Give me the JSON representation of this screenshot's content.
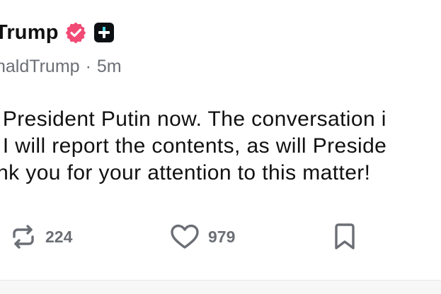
{
  "post": {
    "author_name": "Trump",
    "handle": "naldTrump",
    "separator": "·",
    "time_ago": "5m",
    "body_lines": [
      "o President Putin now. The conversation i",
      "d I will report the contents, as will Preside",
      "ank you for your attention to this matter!"
    ]
  },
  "actions": {
    "repost_count": "224",
    "like_count": "979"
  },
  "icons": {
    "verified": "verified-badge-icon",
    "plus": "plus-badge-icon",
    "repost": "repost-icon",
    "like": "heart-icon",
    "bookmark": "bookmark-icon"
  },
  "colors": {
    "verified_badge": "#f14a74",
    "plus_badge_bg": "#0d1013",
    "plus_badge_accent": "#4dd7e8",
    "muted_text": "#6b6f75"
  }
}
